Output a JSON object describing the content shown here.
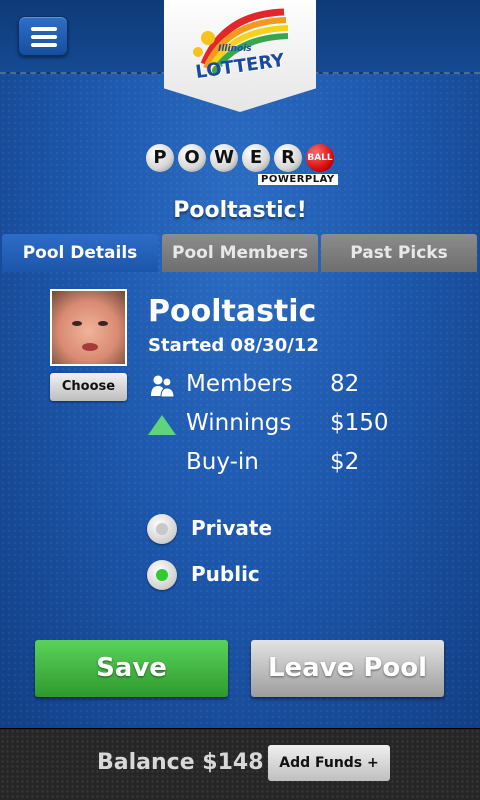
{
  "header": {
    "menu_icon": "hamburger-menu-icon",
    "logo": {
      "state": "Illinois",
      "brand": "LOTTERY"
    }
  },
  "game_logo": {
    "balls": [
      "P",
      "O",
      "W",
      "E",
      "R"
    ],
    "ball_red": "BALL",
    "powerplay": "POWERPLAY"
  },
  "page": {
    "title": "Pooltastic!"
  },
  "tabs": [
    {
      "label": "Pool Details",
      "active": true
    },
    {
      "label": "Pool Members",
      "active": false
    },
    {
      "label": "Past Picks",
      "active": false
    }
  ],
  "pool": {
    "name": "Pooltastic",
    "started": "Started 08/30/12",
    "choose_label": "Choose",
    "stats": {
      "members_label": "Members",
      "members_value": "82",
      "winnings_label": "Winnings",
      "winnings_value": "$150",
      "buyin_label": "Buy-in",
      "buyin_value": "$2"
    },
    "privacy": {
      "private_label": "Private",
      "public_label": "Public",
      "selected": "Public"
    }
  },
  "actions": {
    "save_label": "Save",
    "leave_label": "Leave Pool"
  },
  "footer": {
    "balance": "Balance $148",
    "add_funds_label": "Add Funds +"
  },
  "colors": {
    "background": "#1a56a8",
    "save_green": "#3fb83f",
    "accent_green": "#5fd47b",
    "radio_selected": "#2fcc2f"
  }
}
